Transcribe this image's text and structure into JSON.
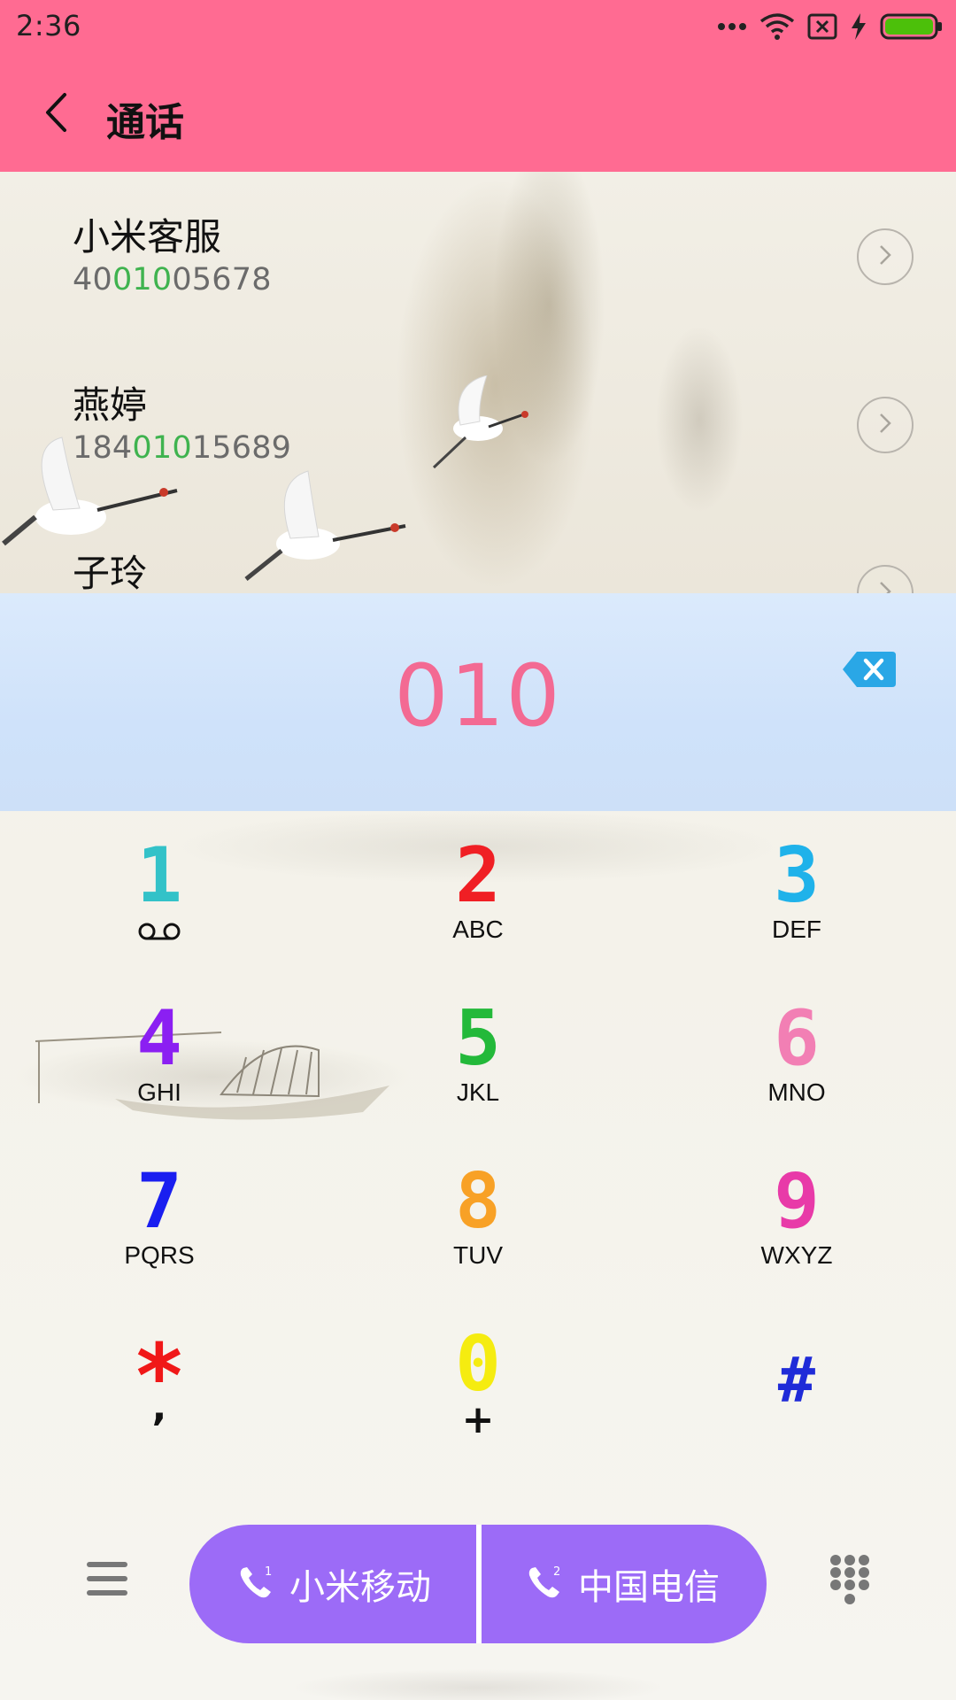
{
  "status_bar": {
    "time": "2:36",
    "icons": [
      "more-dots-icon",
      "wifi-icon",
      "no-sim-icon",
      "charging-bolt-icon",
      "battery-icon"
    ],
    "battery_color": "#4cc00a"
  },
  "header": {
    "title": "通话",
    "back_icon": "chevron-left-icon",
    "background": "#ff6b92"
  },
  "results": [
    {
      "name": "小米客服",
      "number_parts": [
        "40",
        "010",
        "05678"
      ]
    },
    {
      "name": "燕婷",
      "number_parts": [
        "184",
        "010",
        "15689"
      ]
    },
    {
      "name": "子玲",
      "number_parts": []
    }
  ],
  "dial": {
    "number": "010",
    "number_color": "#f36a93",
    "backspace_icon": "backspace-icon",
    "backspace_color": "#2aa7e6"
  },
  "keypad": {
    "keys": [
      {
        "digit": "1",
        "letters": "",
        "color": "#33c2c8",
        "sub_icon": "voicemail-icon"
      },
      {
        "digit": "2",
        "letters": "ABC",
        "color": "#f01f24"
      },
      {
        "digit": "3",
        "letters": "DEF",
        "color": "#1fb2ea"
      },
      {
        "digit": "4",
        "letters": "GHI",
        "color": "#8b1ff2"
      },
      {
        "digit": "5",
        "letters": "JKL",
        "color": "#23b93a"
      },
      {
        "digit": "6",
        "letters": "MNO",
        "color": "#f27fb4"
      },
      {
        "digit": "7",
        "letters": "PQRS",
        "color": "#1a1ef0"
      },
      {
        "digit": "8",
        "letters": "TUV",
        "color": "#f8a126"
      },
      {
        "digit": "9",
        "letters": "WXYZ",
        "color": "#e83aa8"
      },
      {
        "digit": "*",
        "sub": ",",
        "color": "#f01818"
      },
      {
        "digit": "0",
        "sub": "+",
        "color": "#f5ec10"
      },
      {
        "digit": "#",
        "sub": "",
        "color": "#1f2bd8"
      }
    ]
  },
  "bottom_bar": {
    "menu_icon": "hamburger-menu-icon",
    "sim1": {
      "label": "小米移动",
      "icon": "phone-sim1-icon",
      "badge": "1"
    },
    "sim2": {
      "label": "中国电信",
      "icon": "phone-sim2-icon",
      "badge": "2"
    },
    "call_button_color": "#9c6bf7",
    "dialpad_icon": "dialpad-toggle-icon"
  }
}
